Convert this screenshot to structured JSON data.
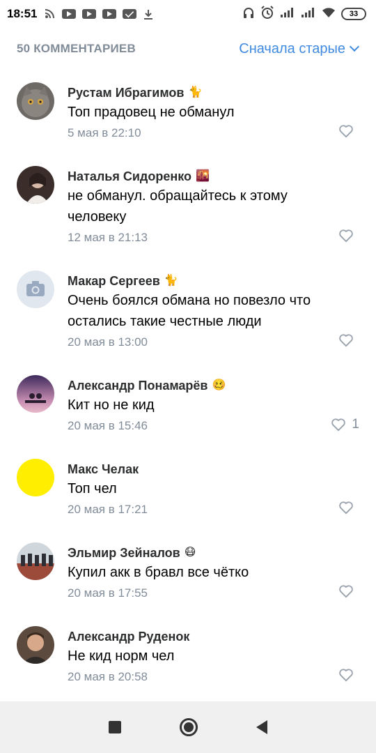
{
  "status_bar": {
    "time": "18:51",
    "battery": "33"
  },
  "header": {
    "count_label": "50 КОММЕНТАРИЕВ",
    "sort_label": "Сначала старые"
  },
  "comments": [
    {
      "name": "Рустам Ибрагимов",
      "emoji": "🐈",
      "text": "Топ прадовец не обманул",
      "date": "5 мая в 22:10",
      "likes": ""
    },
    {
      "name": "Наталья Сидоренко",
      "emoji": "🌇",
      "text": "не обманул. обращайтесь к этому человеку",
      "date": "12 мая в 21:13",
      "likes": ""
    },
    {
      "name": "Макар Сергеев",
      "emoji": "🐈",
      "text": "Очень боялся обмана но повезло что остались такие честные люди",
      "date": "20 мая в 13:00",
      "likes": ""
    },
    {
      "name": "Александр Понамарёв",
      "emoji": "🥴",
      "text": "Кит но не кид",
      "date": "20 мая в 15:46",
      "likes": "1"
    },
    {
      "name": "Макс Челак",
      "emoji": "",
      "text": "Топ чел",
      "date": "20 мая в 17:21",
      "likes": ""
    },
    {
      "name": "Эльмир Зейналов",
      "emoji": "😷",
      "text": "Купил акк в бравл все чётко",
      "date": "20 мая в 17:55",
      "likes": ""
    },
    {
      "name": "Александр Руденок",
      "emoji": "",
      "text": "Не кид норм чел",
      "date": "20 мая в 20:58",
      "likes": ""
    }
  ],
  "colors": {
    "accent": "#3f8ae0",
    "secondary_text": "#818c99",
    "avatar_yellow": "#ffee00"
  }
}
